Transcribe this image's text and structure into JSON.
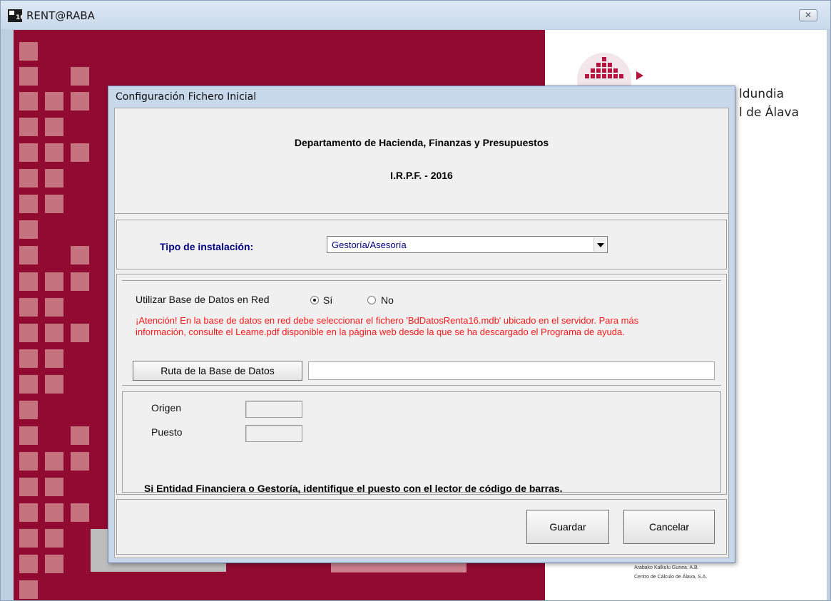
{
  "app": {
    "title": "RENT@RABA",
    "close_glyph": "✕",
    "logo_lines": [
      "ldundia",
      "l de Álava"
    ],
    "footer_lines": [
      "Arabako Kalkulu Gunea, A.B.",
      "Centro de Cálculo de Álava, S.A."
    ],
    "colors": {
      "maroon": "#910a31",
      "square": "#c4737f"
    }
  },
  "dialog": {
    "title": "Configuración Fichero Inicial",
    "header": {
      "department": "Departamento de Hacienda, Finanzas y Presupuestos",
      "irpf": "I.R.P.F. - 2016"
    },
    "install": {
      "label": "Tipo de instalación:",
      "selected": "Gestoría/Asesoría",
      "dropdown_icon": "chevron-down-icon"
    },
    "network": {
      "label": "Utilizar Base de Datos en Red",
      "yes_label": "Sí",
      "no_label": "No",
      "selected": "Sí",
      "warning": "¡Atención! En la base de datos en red debe seleccionar el fichero 'BdDatosRenta16.mdb' ubicado en el servidor. Para más información, consulte el Leame.pdf disponible en la página web desde la que se ha descargado el Programa de ayuda.",
      "path_button": "Ruta de la Base de Datos",
      "path_value": ""
    },
    "position": {
      "origin_label": "Origen",
      "origin_value": "",
      "post_label": "Puesto",
      "post_value": "",
      "note": "Si Entidad Financiera o Gestoría, identifique el puesto con el lector de código de barras."
    },
    "buttons": {
      "save": "Guardar",
      "cancel": "Cancelar"
    }
  }
}
